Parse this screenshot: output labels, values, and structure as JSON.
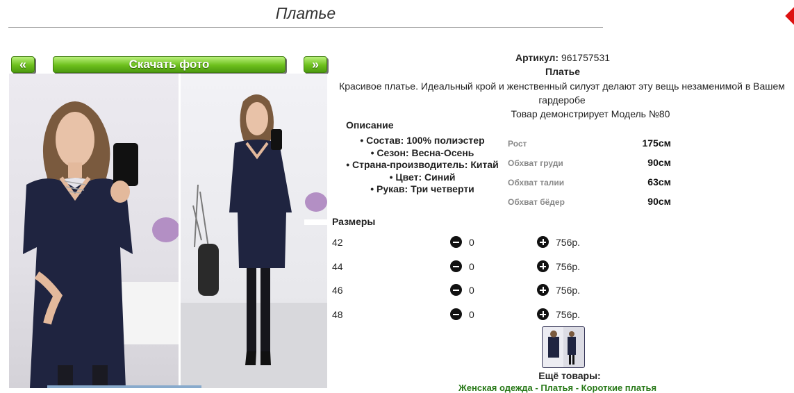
{
  "page": {
    "title": "Платье"
  },
  "gallery": {
    "prev_label": "«",
    "download_label": "Скачать фото",
    "next_label": "»"
  },
  "product": {
    "article_label": "Артикул:",
    "article_value": "961757531",
    "name": "Платье",
    "description": "Красивое платье. Идеальный крой и женственный силуэт делают эту вещь незаменимой в Вашем гардеробе",
    "model_note": "Товар демонстрирует Модель №80"
  },
  "description": {
    "heading": "Описание",
    "items": [
      "Состав: 100% полиэстер",
      "Сезон: Весна-Осень",
      "Страна-производитель: Китай",
      "Цвет: Синий",
      "Рукав: Три четверти"
    ]
  },
  "measurements": [
    {
      "label": "Рост",
      "value": "175см"
    },
    {
      "label": "Обхват груди",
      "value": "90см"
    },
    {
      "label": "Обхват талии",
      "value": "63см"
    },
    {
      "label": "Обхват бёдер",
      "value": "90см"
    }
  ],
  "sizes": {
    "heading": "Размеры",
    "rows": [
      {
        "size": "42",
        "qty": "0",
        "price": "756р."
      },
      {
        "size": "44",
        "qty": "0",
        "price": "756р."
      },
      {
        "size": "46",
        "qty": "0",
        "price": "756р."
      },
      {
        "size": "48",
        "qty": "0",
        "price": "756р."
      }
    ]
  },
  "more": {
    "heading": "Ещё товары:",
    "links": "Женская одежда - Платья - Короткие платья"
  },
  "colors": {
    "button_green": "#6cbf1c",
    "link_green": "#2a7a1a",
    "dress_navy": "#1f2440"
  }
}
